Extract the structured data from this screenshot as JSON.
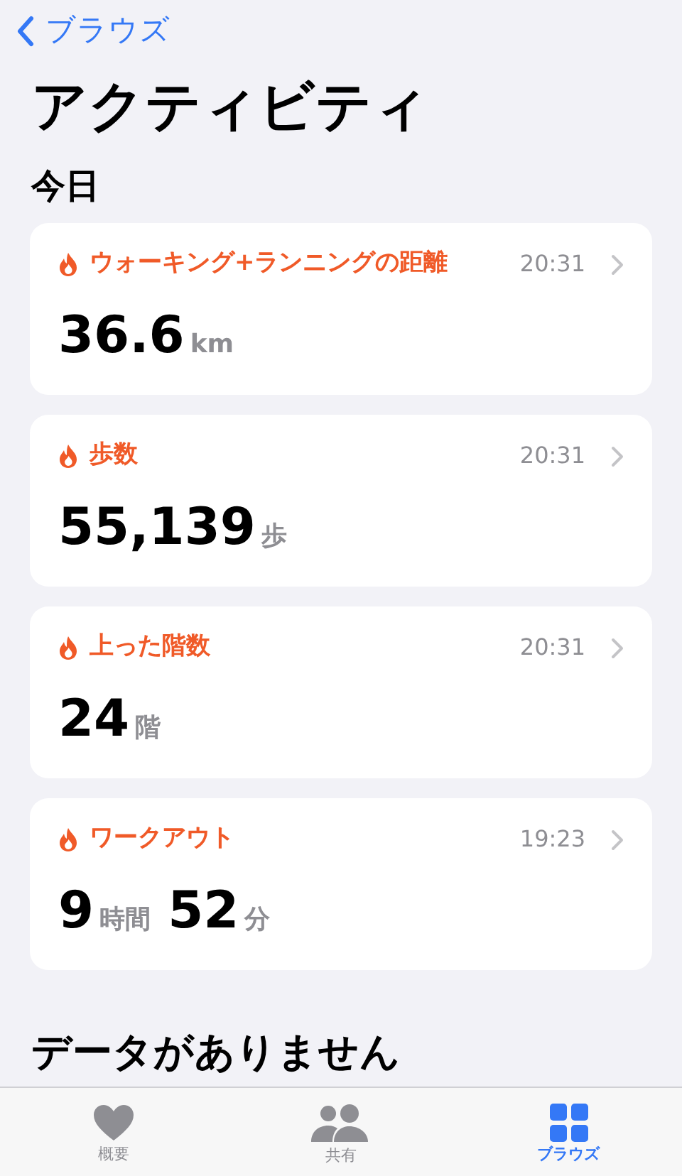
{
  "nav": {
    "back_label": "ブラウズ"
  },
  "title": "アクティビティ",
  "section": "今日",
  "cards": [
    {
      "title": "ウォーキング+ランニングの距離",
      "time": "20:31",
      "value": [
        {
          "kind": "number",
          "text": "36.6"
        },
        {
          "kind": "unit",
          "text": "km"
        }
      ]
    },
    {
      "title": "歩数",
      "time": "20:31",
      "value": [
        {
          "kind": "number",
          "text": "55,139"
        },
        {
          "kind": "unit",
          "text": "歩"
        }
      ]
    },
    {
      "title": "上った階数",
      "time": "20:31",
      "value": [
        {
          "kind": "number",
          "text": "24"
        },
        {
          "kind": "unit",
          "text": "階"
        }
      ]
    },
    {
      "title": "ワークアウト",
      "time": "19:23",
      "value": [
        {
          "kind": "number",
          "text": "9"
        },
        {
          "kind": "unit",
          "text": "時間"
        },
        {
          "kind": "number",
          "text": "52"
        },
        {
          "kind": "unit",
          "text": "分"
        }
      ]
    }
  ],
  "next_section": "データがありません",
  "tab_bar": [
    {
      "label": "概要",
      "selected": false
    },
    {
      "label": "共有",
      "selected": false
    },
    {
      "label": "ブラウズ",
      "selected": true
    }
  ]
}
